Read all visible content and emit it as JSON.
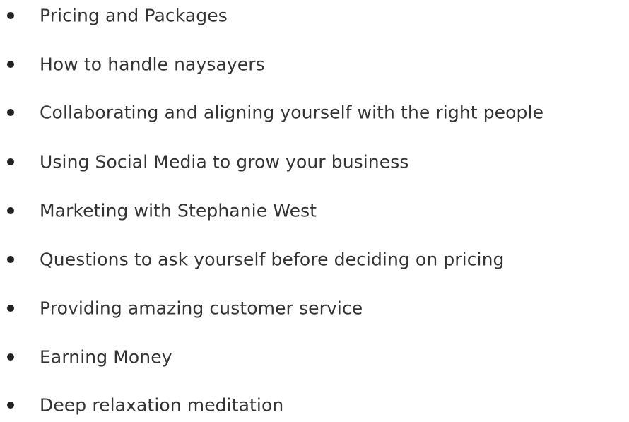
{
  "list": {
    "items": [
      "Pricing and Packages",
      "How to handle naysayers",
      "Collaborating and aligning yourself with the right people",
      "Using Social Media to grow your business",
      "Marketing with Stephanie West",
      "Questions to ask yourself before deciding on pricing",
      "Providing amazing customer service",
      "Earning Money",
      "Deep relaxation meditation"
    ]
  },
  "colors": {
    "text": "#333333",
    "bullet": "#222222",
    "background": "#ffffff"
  },
  "icons": {
    "bullet": "bullet-icon"
  }
}
